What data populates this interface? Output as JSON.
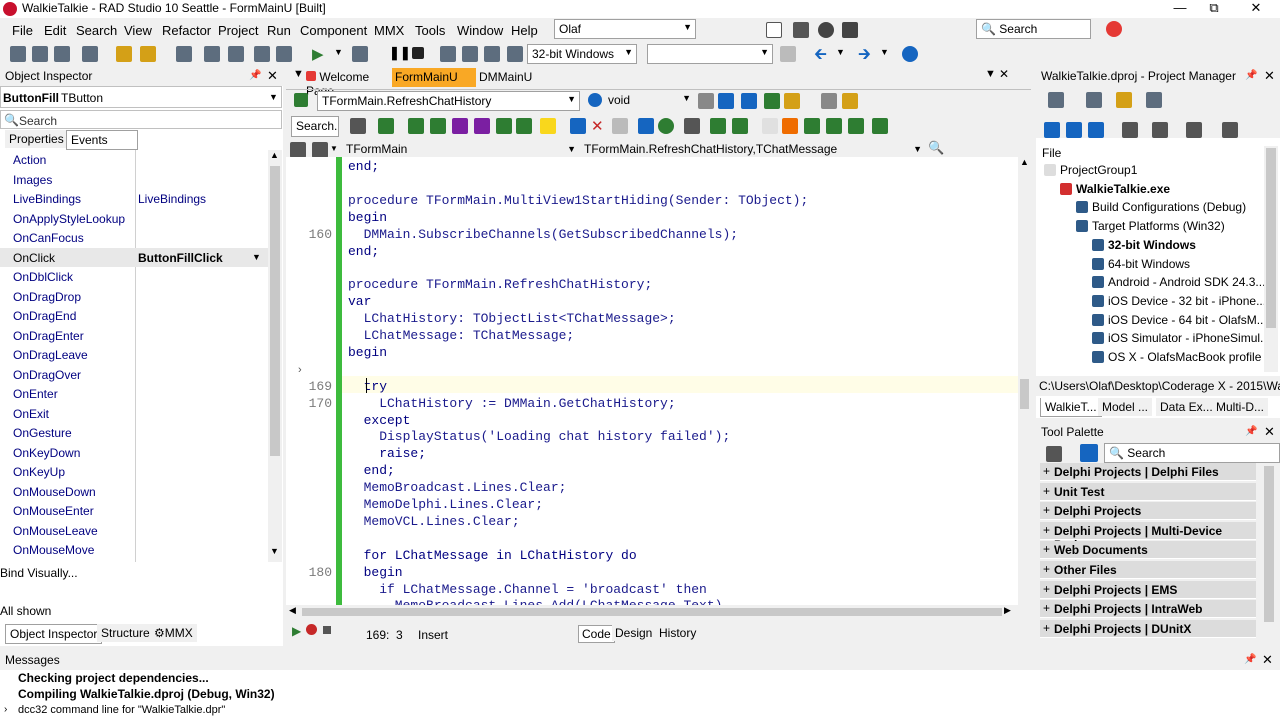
{
  "window": {
    "title": "WalkieTalkie - RAD Studio 10 Seattle - FormMainU [Built]"
  },
  "menu": [
    "File",
    "Edit",
    "Search",
    "View",
    "Refactor",
    "Project",
    "Run",
    "Component",
    "MMX",
    "Tools",
    "Window",
    "Help"
  ],
  "toolbar": {
    "desktop": "Olaf",
    "platform": "32-bit Windows",
    "search_placeholder": "Search"
  },
  "object_inspector": {
    "title": "Object Inspector",
    "component_name": "ButtonFill",
    "component_type": "TButton",
    "search_placeholder": "Search",
    "tabs": [
      "Properties",
      "Events"
    ],
    "rows": [
      {
        "name": "Action",
        "value": ""
      },
      {
        "name": "Images",
        "value": ""
      },
      {
        "name": "LiveBindings",
        "value": "LiveBindings"
      },
      {
        "name": "OnApplyStyleLookup",
        "value": ""
      },
      {
        "name": "OnCanFocus",
        "value": ""
      },
      {
        "name": "OnClick",
        "value": "ButtonFillClick"
      },
      {
        "name": "OnDblClick",
        "value": ""
      },
      {
        "name": "OnDragDrop",
        "value": ""
      },
      {
        "name": "OnDragEnd",
        "value": ""
      },
      {
        "name": "OnDragEnter",
        "value": ""
      },
      {
        "name": "OnDragLeave",
        "value": ""
      },
      {
        "name": "OnDragOver",
        "value": ""
      },
      {
        "name": "OnEnter",
        "value": ""
      },
      {
        "name": "OnExit",
        "value": ""
      },
      {
        "name": "OnGesture",
        "value": ""
      },
      {
        "name": "OnKeyDown",
        "value": ""
      },
      {
        "name": "OnKeyUp",
        "value": ""
      },
      {
        "name": "OnMouseDown",
        "value": ""
      },
      {
        "name": "OnMouseEnter",
        "value": ""
      },
      {
        "name": "OnMouseLeave",
        "value": ""
      },
      {
        "name": "OnMouseMove",
        "value": ""
      }
    ],
    "bind_visually": "Bind Visually...",
    "all_shown": "All shown",
    "bottom_tabs": [
      "Object Inspector",
      "Structure",
      "MMX"
    ]
  },
  "editor": {
    "tabs": [
      "Welcome Page",
      "FormMainU",
      "DMMainU"
    ],
    "method_combo": "TFormMain.RefreshChatHistory",
    "return_combo": "void",
    "search_box": "Search...",
    "class_combo": "TFormMain",
    "method_nav": "TFormMain.RefreshChatHistory,TChatMessage",
    "lines": [
      {
        "num": "",
        "code": "end;",
        "kw": true
      },
      {
        "num": "",
        "code": "",
        "kw": false
      },
      {
        "num": "",
        "code": "procedure TFormMain.MultiView1StartHiding(Sender: TObject);",
        "kw": false
      },
      {
        "num": "",
        "code": "begin",
        "kw": true
      },
      {
        "num": "160",
        "code": "  DMMain.SubscribeChannels(GetSubscribedChannels);",
        "kw": false
      },
      {
        "num": "",
        "code": "end;",
        "kw": true
      },
      {
        "num": "",
        "code": "",
        "kw": false
      },
      {
        "num": "",
        "code": "procedure TFormMain.RefreshChatHistory;",
        "kw": false
      },
      {
        "num": "",
        "code": "var",
        "kw": true
      },
      {
        "num": "",
        "code": "  LChatHistory: TObjectList<TChatMessage>;",
        "kw": false
      },
      {
        "num": "",
        "code": "  LChatMessage: TChatMessage;",
        "kw": false
      },
      {
        "num": "",
        "code": "begin",
        "kw": true
      },
      {
        "num": "",
        "code": "",
        "kw": false
      },
      {
        "num": "169",
        "code": "  try",
        "kw": true
      },
      {
        "num": "170",
        "code": "    LChatHistory := DMMain.GetChatHistory;",
        "kw": false
      },
      {
        "num": "",
        "code": "  except",
        "kw": true
      },
      {
        "num": "",
        "code": "    DisplayStatus('Loading chat history failed');",
        "kw": false
      },
      {
        "num": "",
        "code": "    raise;",
        "kw": true
      },
      {
        "num": "",
        "code": "  end;",
        "kw": true
      },
      {
        "num": "",
        "code": "  MemoBroadcast.Lines.Clear;",
        "kw": false
      },
      {
        "num": "",
        "code": "  MemoDelphi.Lines.Clear;",
        "kw": false
      },
      {
        "num": "",
        "code": "  MemoVCL.Lines.Clear;",
        "kw": false
      },
      {
        "num": "",
        "code": "",
        "kw": false
      },
      {
        "num": "",
        "code": "  for LChatMessage in LChatHistory do",
        "kw": true
      },
      {
        "num": "180",
        "code": "  begin",
        "kw": true
      },
      {
        "num": "",
        "code": "    if LChatMessage.Channel = 'broadcast' then",
        "kw": false
      },
      {
        "num": "",
        "code": "      MemoBroadcast.Lines.Add(LChatMessage.Text)",
        "kw": false
      }
    ],
    "status_pos": "169:  3",
    "status_mode": "Insert",
    "view_tabs": [
      "Code",
      "Design",
      "History"
    ]
  },
  "project_manager": {
    "title": "WalkieTalkie.dproj - Project Manager",
    "file_label": "File",
    "tree": [
      {
        "label": "ProjectGroup1",
        "indent": 0,
        "bold": false
      },
      {
        "label": "WalkieTalkie.exe",
        "indent": 1,
        "bold": true
      },
      {
        "label": "Build Configurations (Debug)",
        "indent": 2,
        "bold": false
      },
      {
        "label": "Target Platforms (Win32)",
        "indent": 2,
        "bold": false
      },
      {
        "label": "32-bit Windows",
        "indent": 3,
        "bold": true
      },
      {
        "label": "64-bit Windows",
        "indent": 3,
        "bold": false
      },
      {
        "label": "Android - Android SDK 24.3....",
        "indent": 3,
        "bold": false
      },
      {
        "label": "iOS Device - 32 bit - iPhone....",
        "indent": 3,
        "bold": false
      },
      {
        "label": "iOS Device - 64 bit - OlafsM...",
        "indent": 3,
        "bold": false
      },
      {
        "label": "iOS Simulator - iPhoneSimul...",
        "indent": 3,
        "bold": false
      },
      {
        "label": "OS X - OlafsMacBook profile",
        "indent": 3,
        "bold": false
      }
    ],
    "path": "C:\\Users\\Olaf\\Desktop\\Coderage X - 2015\\Wa",
    "tabs": [
      "WalkieT...",
      "Model ...",
      "Data Ex...",
      "Multi-D..."
    ]
  },
  "tool_palette": {
    "title": "Tool Palette",
    "search_placeholder": "Search",
    "items": [
      "Delphi Projects | Delphi Files",
      "Unit Test",
      "Delphi Projects",
      "Delphi Projects | Multi-Device Proje...",
      "Web Documents",
      "Other Files",
      "Delphi Projects | EMS",
      "Delphi Projects | IntraWeb",
      "Delphi Projects | DUnitX"
    ]
  },
  "messages": {
    "title": "Messages",
    "lines": [
      "Checking project dependencies...",
      "Compiling WalkieTalkie.dproj (Debug, Win32)",
      "dcc32 command line for \"WalkieTalkie.dpr\""
    ]
  }
}
